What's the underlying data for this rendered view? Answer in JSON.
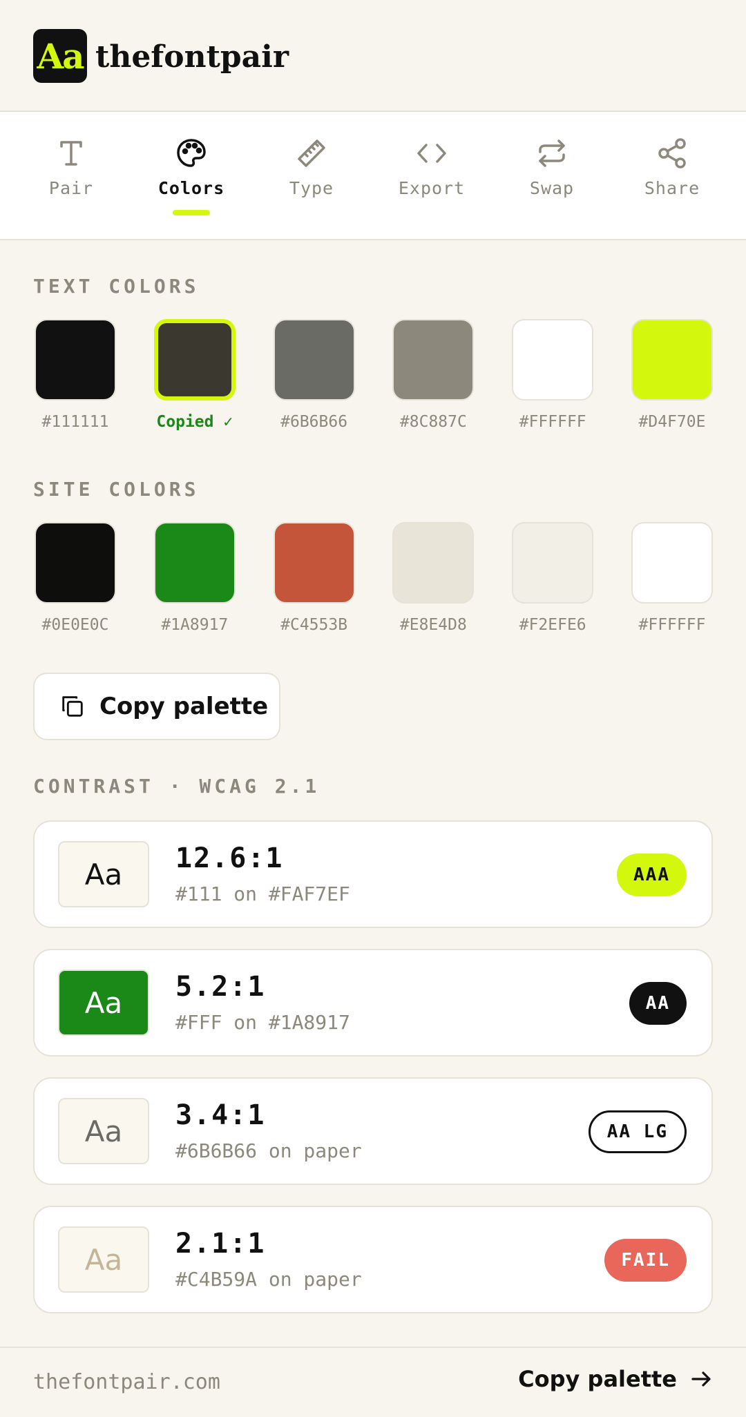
{
  "brand": {
    "mark": "Aa",
    "name": "thefontpair"
  },
  "tabs": [
    {
      "label": "Pair",
      "icon": "type-icon",
      "active": false
    },
    {
      "label": "Colors",
      "icon": "palette-icon",
      "active": true
    },
    {
      "label": "Type",
      "icon": "ruler-icon",
      "active": false
    },
    {
      "label": "Export",
      "icon": "code-icon",
      "active": false
    },
    {
      "label": "Swap",
      "icon": "swap-icon",
      "active": false
    },
    {
      "label": "Share",
      "icon": "share-icon",
      "active": false
    }
  ],
  "text_colors": {
    "title": "TEXT COLORS",
    "swatches": [
      {
        "color": "#111111",
        "label": "#111111"
      },
      {
        "color": "#3B3830",
        "label": "Copied ✓",
        "selected": true
      },
      {
        "color": "#6B6B66",
        "label": "#6B6B66"
      },
      {
        "color": "#8C887C",
        "label": "#8C887C"
      },
      {
        "color": "#FFFFFF",
        "label": "#FFFFFF"
      },
      {
        "color": "#D4F70E",
        "label": "#D4F70E"
      }
    ]
  },
  "site_colors": {
    "title": "SITE COLORS",
    "swatches": [
      {
        "color": "#0E0E0C",
        "label": "#0E0E0C"
      },
      {
        "color": "#1A8917",
        "label": "#1A8917"
      },
      {
        "color": "#C4553B",
        "label": "#C4553B"
      },
      {
        "color": "#E8E4D8",
        "label": "#E8E4D8"
      },
      {
        "color": "#F2EFE6",
        "label": "#F2EFE6"
      },
      {
        "color": "#FFFFFF",
        "label": "#FFFFFF"
      }
    ]
  },
  "copy_button": {
    "label": "Copy palette",
    "icon": "copy-icon"
  },
  "contrast": {
    "title": "CONTRAST · WCAG 2.1",
    "cards": [
      {
        "sample": "Aa",
        "ratio": "12.6:1",
        "desc": "#111 on #FAF7EF",
        "badge": "AAA",
        "sample_bg": "#FAF7EF",
        "sample_fg": "#111111",
        "badge_bg": "#D4F70E",
        "badge_fg": "#111111"
      },
      {
        "sample": "Aa",
        "ratio": "5.2:1",
        "desc": "#FFF on #1A8917",
        "badge": "AA",
        "sample_bg": "#1A8917",
        "sample_fg": "#FFFFFF",
        "badge_bg": "#111111",
        "badge_fg": "#FFFFFF"
      },
      {
        "sample": "Aa",
        "ratio": "3.4:1",
        "desc": "#6B6B66 on paper",
        "badge": "AA LG",
        "sample_bg": "#FAF7EF",
        "sample_fg": "#6B6B66",
        "badge_bg": "#FFFFFF",
        "badge_fg": "#111111"
      },
      {
        "sample": "Aa",
        "ratio": "2.1:1",
        "desc": "#C4B59A on paper",
        "badge": "FAIL",
        "sample_bg": "#FAF7EF",
        "sample_fg": "#C4B59A",
        "badge_bg": "#E8665A",
        "badge_fg": "#FFFFFF"
      }
    ]
  },
  "footer": {
    "domain": "thefontpair.com",
    "cta": "Copy palette",
    "cta_icon": "arrow-right-icon"
  },
  "colors": {
    "accent": "#D4F70E",
    "paper": "#F8F5EE",
    "success": "#1A8917"
  }
}
